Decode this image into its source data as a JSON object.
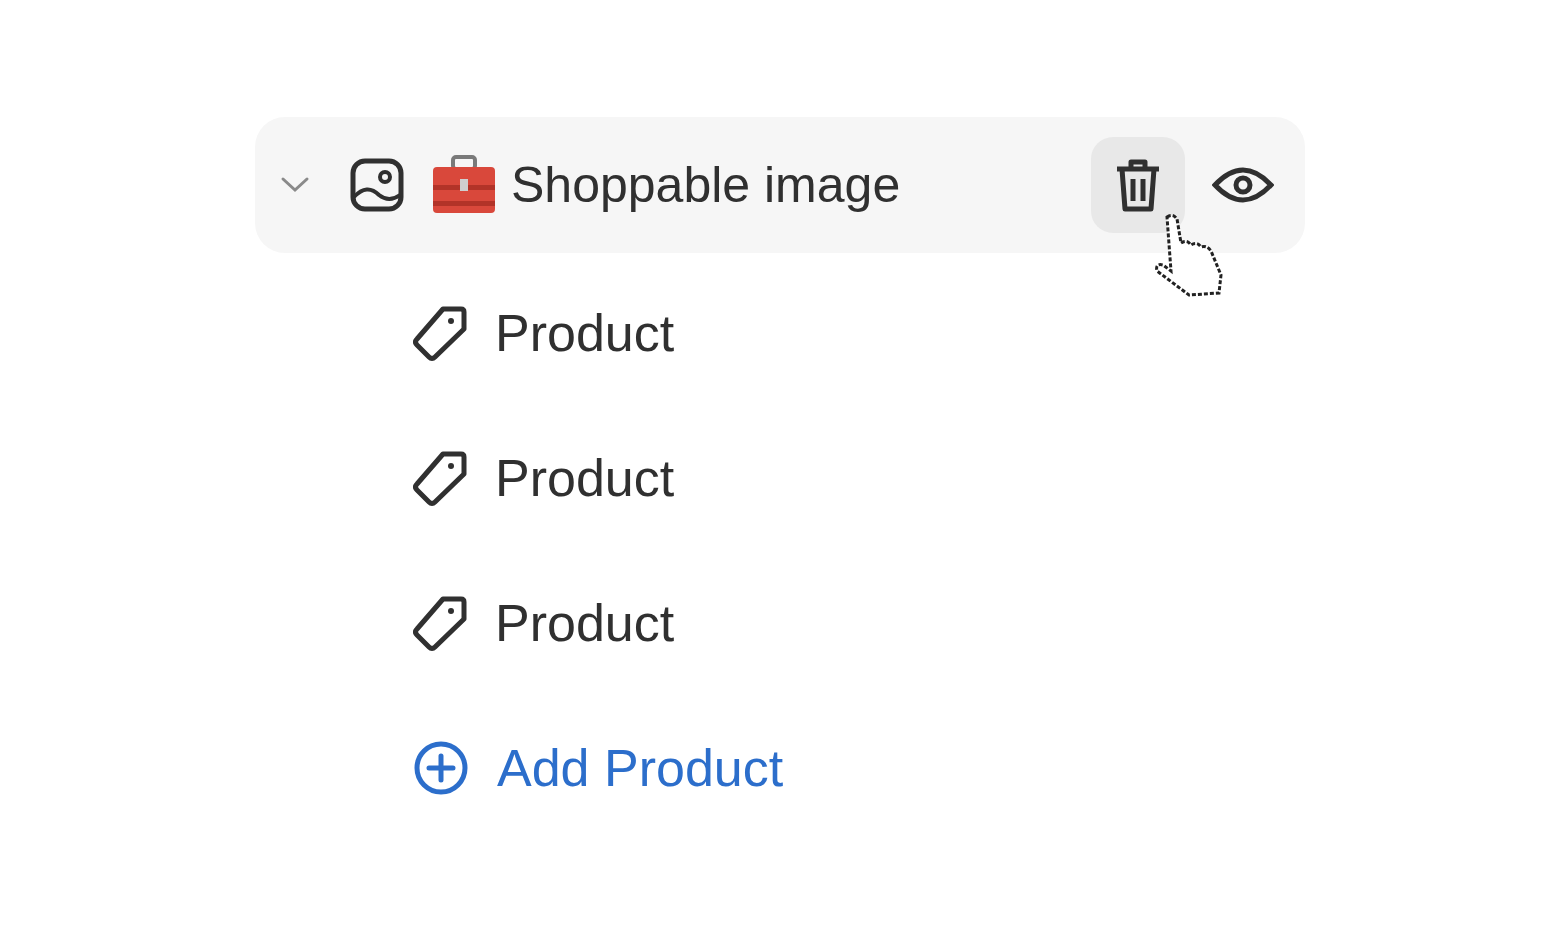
{
  "block": {
    "title": "Shoppable image",
    "expanded": true,
    "children": [
      {
        "label": "Product"
      },
      {
        "label": "Product"
      },
      {
        "label": "Product"
      }
    ],
    "add_label": "Add Product"
  }
}
